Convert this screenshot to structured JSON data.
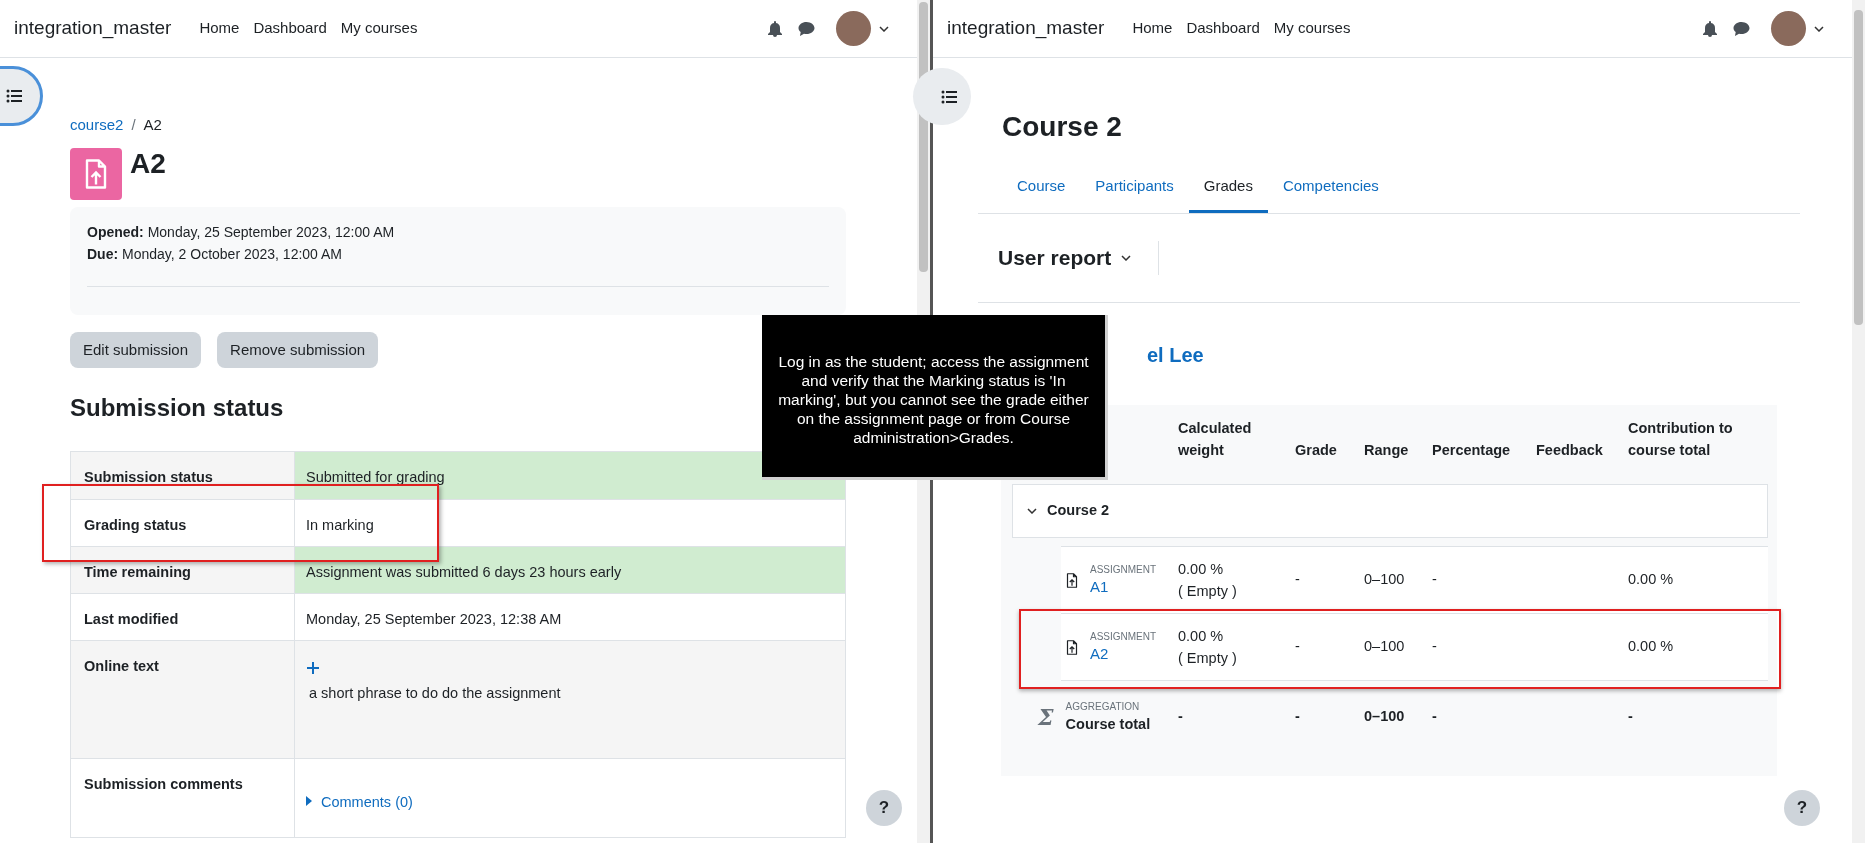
{
  "left_pane": {
    "navbar": {
      "brand": "integration_master",
      "links": [
        "Home",
        "Dashboard",
        "My courses"
      ]
    },
    "breadcrumb": [
      "course2",
      "A2"
    ],
    "breadcrumb_separator": "/",
    "title": "A2",
    "dates": [
      {
        "label": "Opened:",
        "value": "Monday, 25 September 2023, 12:00 AM"
      },
      {
        "label": "Due:",
        "value": "Monday, 2 October 2023, 12:00 AM"
      }
    ],
    "buttons": [
      "Edit submission",
      "Remove submission"
    ],
    "section_heading": "Submission status",
    "status_table": [
      {
        "kind": "text",
        "label": "Submission status",
        "value": "Submitted for grading",
        "highlight": true,
        "annotated": false
      },
      {
        "kind": "text",
        "label": "Grading status",
        "value": "In marking",
        "highlight": false,
        "annotated": true
      },
      {
        "kind": "text",
        "label": "Time remaining",
        "value": "Assignment was submitted 6 days 23 hours early",
        "highlight": true,
        "annotated": false
      },
      {
        "kind": "text",
        "label": "Last modified",
        "value": "Monday, 25 September 2023, 12:38 AM",
        "highlight": false,
        "annotated": false
      },
      {
        "kind": "online_text",
        "label": "Online text",
        "value": "a short phrase to do do the assignment",
        "highlight": false,
        "annotated": false
      },
      {
        "kind": "comments",
        "label": "Submission comments",
        "value": "Comments (0)",
        "highlight": false,
        "annotated": false
      }
    ],
    "help_button": "?"
  },
  "right_pane": {
    "navbar": {
      "brand": "integration_master",
      "links": [
        "Home",
        "Dashboard",
        "My courses"
      ]
    },
    "title": "Course 2",
    "tabs": [
      {
        "label": "Course",
        "selected": false
      },
      {
        "label": "Participants",
        "selected": false
      },
      {
        "label": "Grades",
        "selected": true
      },
      {
        "label": "Competencies",
        "selected": false
      }
    ],
    "report_selector": "User report",
    "user_name": "el Lee",
    "grade_table": {
      "columns": [
        "Calculated weight",
        "Grade",
        "Range",
        "Percentage",
        "Feedback",
        "Contribution to course total"
      ],
      "category": "Course 2",
      "items": [
        {
          "type_label": "ASSIGNMENT",
          "name": "A1",
          "weight": "0.00 %",
          "weight_note": "( Empty )",
          "grade": "-",
          "range": "0–100",
          "percentage": "-",
          "contribution": "0.00 %",
          "annotated": false
        },
        {
          "type_label": "ASSIGNMENT",
          "name": "A2",
          "weight": "0.00 %",
          "weight_note": "( Empty )",
          "grade": "-",
          "range": "0–100",
          "percentage": "-",
          "contribution": "0.00 %",
          "annotated": true
        }
      ],
      "total": {
        "symbol": "Σ",
        "type_label": "AGGREGATION",
        "name": "Course total",
        "weight": "-",
        "grade": "-",
        "range": "0–100",
        "percentage": "-",
        "contribution": "-"
      }
    },
    "help_button": "?"
  },
  "annotation": {
    "text": "Log in as the student; access the assignment and verify that the Marking status is 'In marking', but you cannot see the grade either on the assignment page or from Course administration>Grades."
  }
}
